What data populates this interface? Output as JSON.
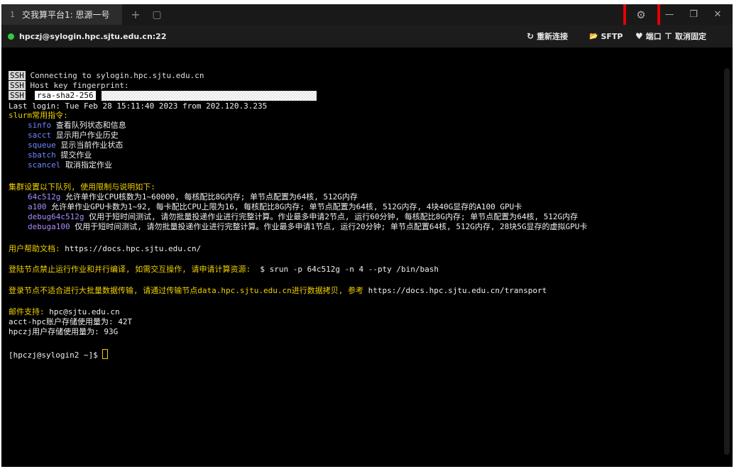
{
  "tab": {
    "number": "1",
    "title": "交我算平台1: 思源一号"
  },
  "tabbar": {
    "new_tab": "+",
    "restore_icon": "▢"
  },
  "window_controls": {
    "settings": "⚙",
    "minimize": "—",
    "maximize": "❐",
    "close": "✕"
  },
  "connection": {
    "host": "hpczj@sylogin.hpc.sjtu.edu.cn:22",
    "status_color": "#2ecc40"
  },
  "actions": {
    "reconnect": "重新连接",
    "sftp": "SFTP",
    "port": "端口",
    "unpin": "取消固定"
  },
  "action_icons": {
    "reconnect": "↻",
    "sftp": "📂",
    "port": "♥",
    "unpin": "⊤"
  },
  "terminal": {
    "ssh_tag": "SSH",
    "ssh_lines": [
      "Connecting to sylogin.hpc.sjtu.edu.cn",
      "Host key fingerprint:",
      "rsa-sha2-256"
    ],
    "last_login": "Last login: Tue Feb 28 15:11:40 2023 from 202.120.3.235",
    "slurm_header": "slurm常用指令:",
    "slurm_cmds": [
      {
        "cmd": "sinfo",
        "desc": "查看队列状态和信息"
      },
      {
        "cmd": "sacct",
        "desc": "显示用户作业历史"
      },
      {
        "cmd": "squeue",
        "desc": "显示当前作业状态"
      },
      {
        "cmd": "sbatch",
        "desc": "提交作业"
      },
      {
        "cmd": "scancel",
        "desc": "取消指定作业"
      }
    ],
    "queue_header": "集群设置以下队列, 使用限制与说明如下:",
    "queues": [
      {
        "name": "64c512g",
        "desc": "允许单作业CPU核数为1~60000, 每核配比8G内存; 单节点配置为64核, 512G内存"
      },
      {
        "name": "a100",
        "desc": "允许单作业GPU卡数为1~92, 每卡配比CPU上限为16, 每核配比8G内存; 单节点配置为64核, 512G内存, 4块40G显存的A100 GPU卡"
      },
      {
        "name": "debug64c512g",
        "desc": "仅用于短时间测试, 请勿批量投递作业进行完整计算。作业最多申请2节点, 运行60分钟, 每核配比8G内存; 单节点配置为64核, 512G内存"
      },
      {
        "name": "debuga100",
        "desc": "仅用于短时间测试, 请勿批量投递作业进行完整计算。作业最多申请1节点, 运行20分钟; 单节点配置64核, 512G内存, 28块5G显存的虚拟GPU卡"
      }
    ],
    "help_label": "用户帮助文档:",
    "help_url": "https://docs.hpc.sjtu.edu.cn/",
    "login_note": "登陆节点禁止运行作业和并行编译, 如需交互操作, 请申请计算资源:",
    "login_cmd": "$ srun -p 64c512g -n 4 --pty /bin/bash",
    "transfer_note": "登录节点不适合进行大批量数据传输, 请通过传输节点data.hpc.sjtu.edu.cn进行数据拷贝, 参考",
    "transfer_url": "https://docs.hpc.sjtu.edu.cn/transport",
    "mail_label": "邮件支持:",
    "mail": "hpc@sjtu.edu.cn",
    "acct_usage": "acct-hpc账户存储使用量为: 42T",
    "user_usage": "hpczj用户存储使用量为: 93G",
    "prompt": "[hpczj@sylogin2 ~]$ "
  }
}
